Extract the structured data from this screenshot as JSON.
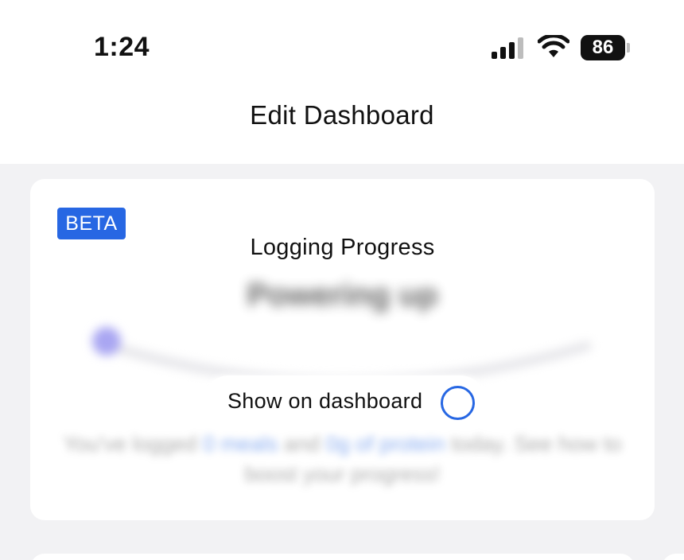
{
  "status_bar": {
    "time": "1:24",
    "battery": "86",
    "icons": [
      "cellular-signal-icon",
      "wifi-icon",
      "battery-icon"
    ]
  },
  "header": {
    "title": "Edit Dashboard"
  },
  "card": {
    "badge": "BETA",
    "title": "Logging Progress",
    "blurred_heading": "Powering up",
    "blurred_body_parts": {
      "pre": "You've logged ",
      "meals": "0 meals",
      "mid": " and ",
      "products": "0g of protein",
      "post": " today. See how to boost your progress!"
    },
    "toggle": {
      "label": "Show on dashboard",
      "checked": false
    }
  },
  "colors": {
    "accent": "#2767e3",
    "background": "#f2f2f4",
    "card": "#ffffff"
  }
}
